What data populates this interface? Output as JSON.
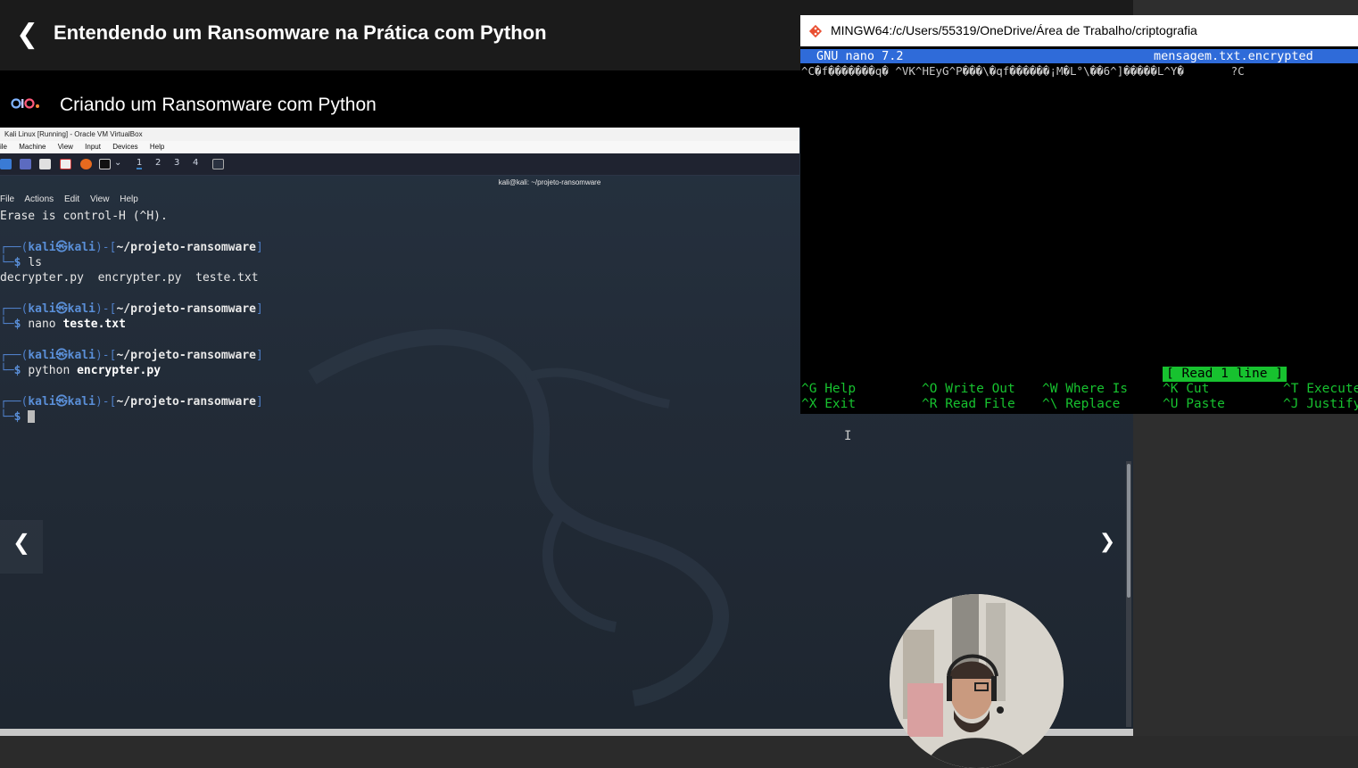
{
  "course": {
    "title": "Entendendo um Ransomware na Prática com Python"
  },
  "lesson": {
    "title": "Criando um Ransomware com Python"
  },
  "virtualbox": {
    "title": "Kali Linux [Running] - Oracle VM VirtualBox",
    "menu": [
      "ile",
      "Machine",
      "View",
      "Input",
      "Devices",
      "Help"
    ],
    "workspaces": [
      "1",
      "2",
      "3",
      "4"
    ]
  },
  "terminal": {
    "window_title": "kali@kali: ~/projeto-ransomware",
    "menu": [
      "File",
      "Actions",
      "Edit",
      "View",
      "Help"
    ],
    "line_erase": "Erase is control-H (^H).",
    "prompt_user": "kali",
    "prompt_sep": "㉿",
    "prompt_host": "kali",
    "prompt_path": "~/projeto-ransomware",
    "cmd1": "ls",
    "ls_output": "decrypter.py  encrypter.py  teste.txt",
    "cmd2": "nano",
    "cmd2_arg": "teste.txt",
    "cmd3": "python",
    "cmd3_arg": "encrypter.py"
  },
  "mingw": {
    "title": "MINGW64:/c/Users/55319/OneDrive/Área de Trabalho/criptografia",
    "nano_version": "GNU nano 7.2",
    "filename": "mensagem.txt.encrypted",
    "content": "^C�f�������q� ^VK^HEyG^P���\\�qf������¡M�L°\\��6^]�����L^Y�       ?C",
    "status": "[ Read 1 line ]",
    "shortcuts": [
      {
        "key": "^G",
        "label": "Help"
      },
      {
        "key": "^O",
        "label": "Write Out"
      },
      {
        "key": "^W",
        "label": "Where Is"
      },
      {
        "key": "^K",
        "label": "Cut"
      },
      {
        "key": "^T",
        "label": "Execute"
      },
      {
        "key": "^X",
        "label": "Exit"
      },
      {
        "key": "^R",
        "label": "Read File"
      },
      {
        "key": "^\\",
        "label": "Replace"
      },
      {
        "key": "^U",
        "label": "Paste"
      },
      {
        "key": "^J",
        "label": "Justify"
      }
    ]
  },
  "colors": {
    "nano_header": "#2f6bd9",
    "nano_green": "#17c22f",
    "prompt_blue": "#5a8fd8"
  }
}
